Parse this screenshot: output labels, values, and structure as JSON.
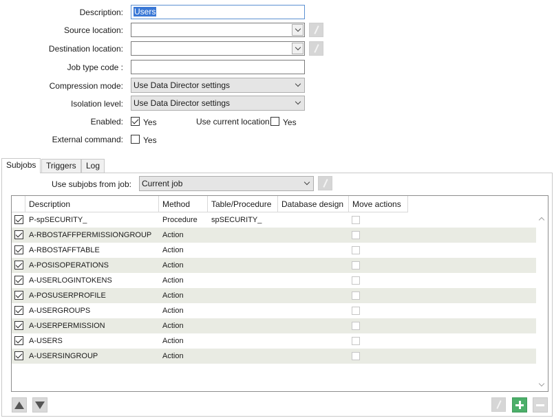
{
  "form": {
    "description_label": "Description:",
    "description_value": "Users",
    "source_label": "Source location:",
    "destination_label": "Destination location:",
    "job_type_label": "Job type code :",
    "compression_label": "Compression mode:",
    "compression_value": "Use Data Director settings",
    "isolation_label": "Isolation level:",
    "isolation_value": "Use Data Director settings",
    "enabled_label": "Enabled:",
    "enabled_yes": "Yes",
    "use_current_label": "Use current location:",
    "use_current_yes": "Yes",
    "external_label": "External command:",
    "external_yes": "Yes"
  },
  "tabs": [
    {
      "label": "Subjobs",
      "active": true
    },
    {
      "label": "Triggers",
      "active": false
    },
    {
      "label": "Log",
      "active": false
    }
  ],
  "subjobs": {
    "use_from_label": "Use subjobs from job:",
    "use_from_value": "Current job",
    "columns": [
      "Description",
      "Method",
      "Table/Procedure",
      "Database design",
      "Move actions"
    ],
    "rows": [
      {
        "checked": true,
        "description": "P-spSECURITY_",
        "method": "Procedure",
        "table": "spSECURITY_",
        "design": ""
      },
      {
        "checked": true,
        "description": "A-RBOSTAFFPERMISSIONGROUP",
        "method": "Action",
        "table": "",
        "design": ""
      },
      {
        "checked": true,
        "description": "A-RBOSTAFFTABLE",
        "method": "Action",
        "table": "",
        "design": ""
      },
      {
        "checked": true,
        "description": "A-POSISOPERATIONS",
        "method": "Action",
        "table": "",
        "design": ""
      },
      {
        "checked": true,
        "description": "A-USERLOGINTOKENS",
        "method": "Action",
        "table": "",
        "design": ""
      },
      {
        "checked": true,
        "description": "A-POSUSERPROFILE",
        "method": "Action",
        "table": "",
        "design": ""
      },
      {
        "checked": true,
        "description": "A-USERGROUPS",
        "method": "Action",
        "table": "",
        "design": ""
      },
      {
        "checked": true,
        "description": "A-USERPERMISSION",
        "method": "Action",
        "table": "",
        "design": ""
      },
      {
        "checked": true,
        "description": "A-USERS",
        "method": "Action",
        "table": "",
        "design": ""
      },
      {
        "checked": true,
        "description": "A-USERSINGROUP",
        "method": "Action",
        "table": "",
        "design": ""
      }
    ]
  },
  "colors": {
    "row_alt": "#e9ebe3",
    "add_button": "#4caf6a",
    "selection": "#3a78d6"
  },
  "icons": {
    "edit": "pencil-icon",
    "move_up": "arrow-up-icon",
    "move_down": "arrow-down-icon",
    "add": "plus-icon",
    "remove": "minus-icon"
  }
}
